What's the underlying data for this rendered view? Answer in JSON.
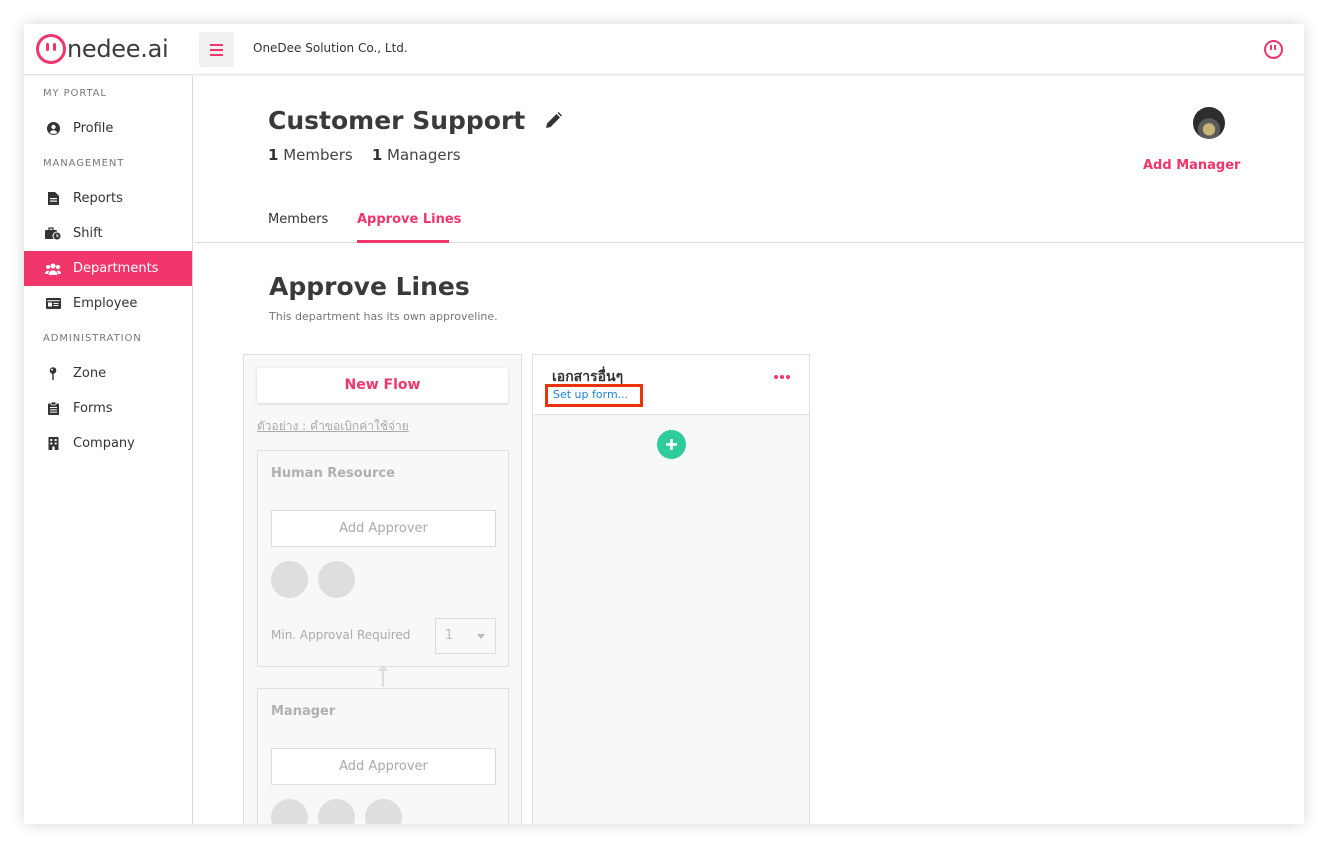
{
  "app": {
    "logo_text": "nedee.ai",
    "company_name": "OneDee Solution Co., Ltd."
  },
  "sidebar": {
    "sections": [
      {
        "title": "MY PORTAL",
        "items": [
          {
            "label": "Profile",
            "icon": "user-circle-icon"
          }
        ]
      },
      {
        "title": "MANAGEMENT",
        "items": [
          {
            "label": "Reports",
            "icon": "document-icon"
          },
          {
            "label": "Shift",
            "icon": "briefcase-clock-icon"
          },
          {
            "label": "Departments",
            "icon": "users-icon",
            "active": true
          },
          {
            "label": "Employee",
            "icon": "id-card-icon"
          }
        ]
      },
      {
        "title": "ADMINISTRATION",
        "items": [
          {
            "label": "Zone",
            "icon": "map-pin-icon"
          },
          {
            "label": "Forms",
            "icon": "clipboard-icon"
          },
          {
            "label": "Company",
            "icon": "building-icon"
          }
        ]
      }
    ]
  },
  "department": {
    "title": "Customer Support",
    "members_count": "1",
    "members_label": "Members",
    "managers_count": "1",
    "managers_label": "Managers",
    "add_manager_label": "Add Manager"
  },
  "tabs": [
    {
      "label": "Members",
      "active": false
    },
    {
      "label": "Approve Lines",
      "active": true
    }
  ],
  "approve_lines": {
    "title": "Approve Lines",
    "subtitle": "This department has its own approveline.",
    "new_flow_label": "New Flow",
    "sample_link": "ตัวอย่าง : คำขอเบิกค่าใช้จ่าย",
    "steps": [
      {
        "name": "Human Resource",
        "add_approver_label": "Add Approver",
        "min_approval_label": "Min. Approval Required",
        "min_approval_value": "1"
      },
      {
        "name": "Manager",
        "add_approver_label": "Add Approver"
      }
    ],
    "flow": {
      "title": "เอกสารอื่นๆ",
      "setup_link": "Set up form..."
    }
  },
  "colors": {
    "accent": "#f0366a",
    "highlight_box": "#e8340e",
    "link": "#1a82d6",
    "add_button": "#2ecc9a"
  }
}
